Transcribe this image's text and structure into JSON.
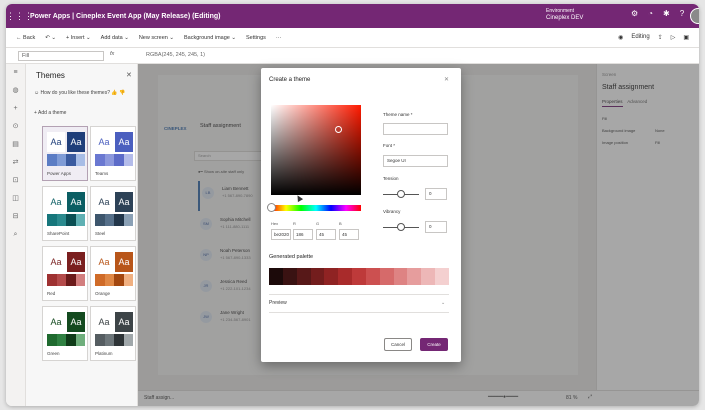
{
  "titlebar": {
    "app_title": "Power Apps  |  Cineplex Event App (May Release) (Editing)",
    "env_label": "Environment",
    "env_value": "Cineplex DEV"
  },
  "cmdbar": {
    "back": "← Back",
    "insert": "+ Insert ⌄",
    "add_data": "Add data ⌄",
    "new_screen": "New screen ⌄",
    "background_image": "Background image ⌄",
    "settings": "Settings",
    "more": "···",
    "editing": "Editing"
  },
  "formulabar": {
    "property": "Fill",
    "fx": "fx",
    "value": "RGBA(245, 245, 245, 1)"
  },
  "themes": {
    "header": "Themes",
    "feedback": "How do you like these themes?",
    "add_theme": "Add a theme",
    "tiles": [
      {
        "name": "Power Apps",
        "aa": "Aa",
        "color1": "#ffffff",
        "color2": "#1f3e7a",
        "swatches": [
          "#5b7cc4",
          "#7f9bd6",
          "#3a5a9f",
          "#a8bde6"
        ]
      },
      {
        "name": "Teams",
        "aa": "Aa",
        "color1": "#ffffff",
        "color2": "#4b5fbf",
        "swatches": [
          "#6a78d1",
          "#8c98dd",
          "#5c6bc8",
          "#b4bcea"
        ]
      },
      {
        "name": "SharePoint",
        "aa": "Aa",
        "color1": "#ffffff",
        "color2": "#0b5e63",
        "swatches": [
          "#16767b",
          "#2a8a8e",
          "#0a4f53",
          "#5fb0b3"
        ]
      },
      {
        "name": "Steel",
        "aa": "Aa",
        "color1": "#ffffff",
        "color2": "#2d4257",
        "swatches": [
          "#3d566d",
          "#56708a",
          "#22364a",
          "#8aa0b5"
        ]
      },
      {
        "name": "Red",
        "aa": "Aa",
        "color1": "#ffffff",
        "color2": "#7a1f1f",
        "swatches": [
          "#9e3131",
          "#b44a4a",
          "#6b1a1a",
          "#d27e7e"
        ]
      },
      {
        "name": "Orange",
        "aa": "Aa",
        "color1": "#ffffff",
        "color2": "#b8561a",
        "swatches": [
          "#cf6b28",
          "#e08845",
          "#a3470f",
          "#f0b081"
        ]
      },
      {
        "name": "Green",
        "aa": "Aa",
        "color1": "#ffffff",
        "color2": "#134a1f",
        "swatches": [
          "#1f6a2f",
          "#2f8142",
          "#0f3b18",
          "#6fae7c"
        ]
      },
      {
        "name": "Platinum",
        "aa": "Aa",
        "color1": "#ffffff",
        "color2": "#3d4447",
        "swatches": [
          "#555d61",
          "#6d767a",
          "#2e3437",
          "#a0a7aa"
        ]
      }
    ]
  },
  "canvas": {
    "brand": "CINEPLEX",
    "screen_title": "Staff assignment",
    "search_placeholder": "Search",
    "toggle_label": "Show on-site staff only",
    "people": [
      {
        "initials": "LB",
        "name": "Liam Bennett",
        "phone": "+1 567-890-7890"
      },
      {
        "initials": "SM",
        "name": "Sophia Mitchell",
        "phone": "+1 111-880-1111"
      },
      {
        "initials": "NP",
        "name": "Noah Peterson",
        "phone": "+1 567-890-1333"
      },
      {
        "initials": "JR",
        "name": "Jessica Reed",
        "phone": "+1 222-101-1234"
      },
      {
        "initials": "JW",
        "name": "Jane Wright",
        "phone": "+1 234-567-8901"
      }
    ]
  },
  "props": {
    "screen_label": "Screen",
    "header": "Staff assignment",
    "tab_properties": "Properties",
    "tab_advanced": "Advanced",
    "fill_label": "Fill",
    "bg_image_label": "Background image",
    "bg_image_value": "None",
    "image_position_label": "Image position",
    "image_position_value": "Fill"
  },
  "statusbar": {
    "screen_tab": "Staff assign...",
    "zoom": "81 %"
  },
  "dialog": {
    "title": "Create a theme",
    "hex_label": "Hex",
    "r_label": "R",
    "g_label": "G",
    "b_label": "B",
    "hex_value": "be2020",
    "r_value": "186",
    "g_value": "45",
    "b_value": "45",
    "theme_name_label": "Theme name *",
    "theme_name_value": "",
    "font_label": "Font *",
    "font_value": "Segoe UI",
    "tension_label": "Tension",
    "tension_value": "0",
    "vibrancy_label": "Vibrancy",
    "vibrancy_value": "0",
    "generated_palette": "Generated palette",
    "palette": [
      "#1c0a0a",
      "#3a1212",
      "#571818",
      "#731d1d",
      "#8f2323",
      "#a92b2b",
      "#be3a3a",
      "#cc5050",
      "#d66a6a",
      "#de8383",
      "#e69d9d",
      "#edb7b7",
      "#f4d0d0"
    ],
    "preview": "Preview",
    "cancel": "Cancel",
    "create": "Create"
  }
}
